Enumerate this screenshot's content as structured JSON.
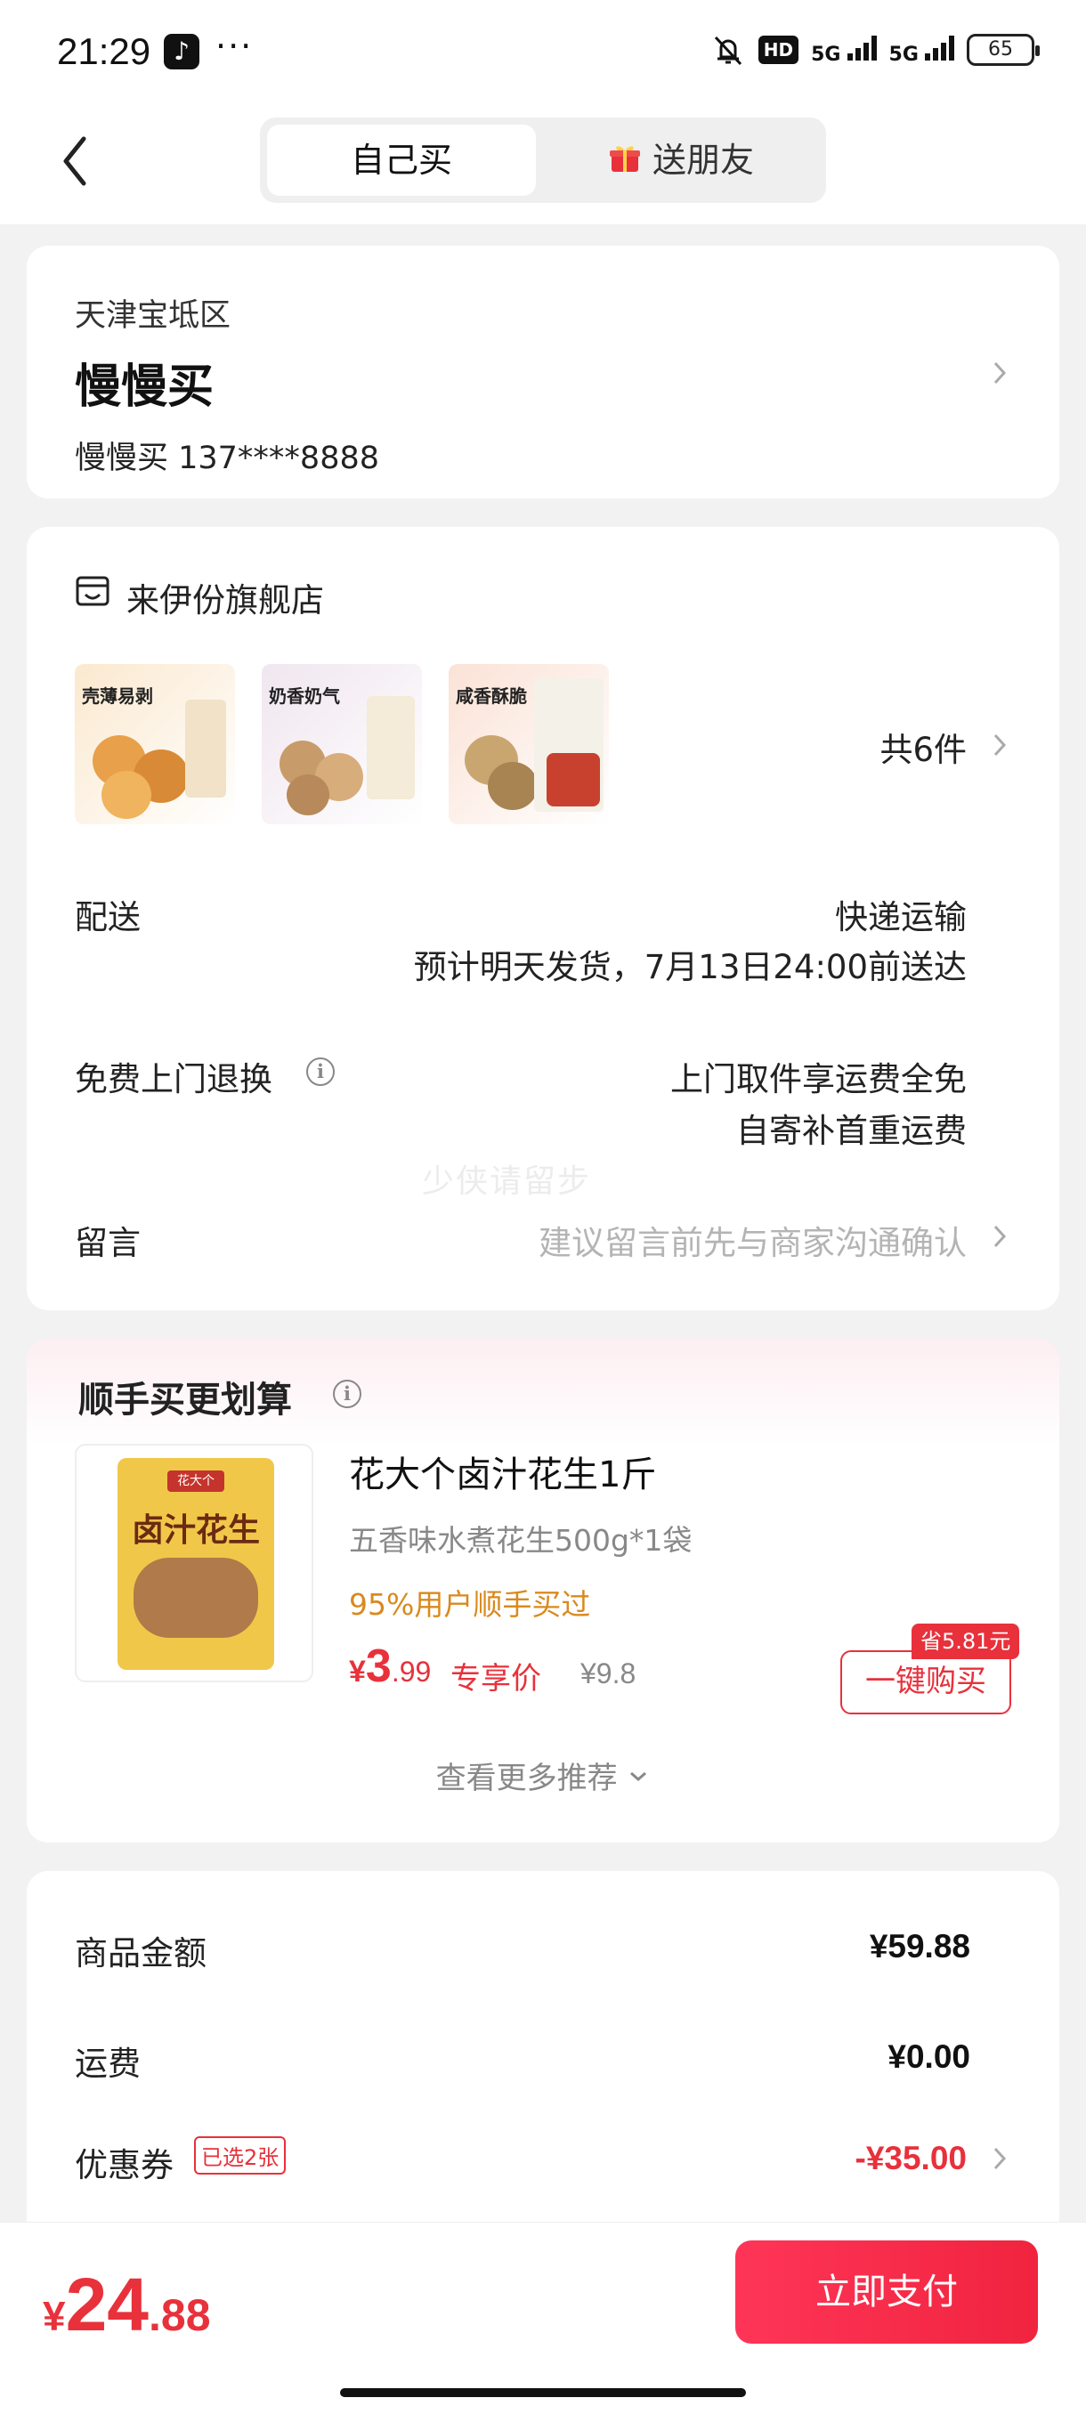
{
  "status_bar": {
    "time": "21:29",
    "hd": "HD",
    "net1": "5G",
    "net2": "5G",
    "battery": "65"
  },
  "header": {
    "tab_self": "自己买",
    "tab_gift": "送朋友"
  },
  "address": {
    "region": "天津宝坻区",
    "name": "慢慢买",
    "contact": "慢慢买  137****8888"
  },
  "order": {
    "store_name": "来伊份旗舰店",
    "products": [
      {
        "tag": "壳薄易剥"
      },
      {
        "tag": "奶香奶气"
      },
      {
        "tag": "咸香酥脆"
      }
    ],
    "total_count": "共6件",
    "delivery_label": "配送",
    "delivery_method": "快递运输",
    "delivery_eta": "预计明天发货，7月13日24:00前送达",
    "return_label": "免费上门退换",
    "return_line1": "上门取件享运费全免",
    "return_line2": "自寄补首重运费",
    "watermark": "少侠请留步",
    "message_label": "留言",
    "message_placeholder": "建议留言前先与商家沟通确认"
  },
  "recommend": {
    "title": "顺手买更划算",
    "package_brand": "花大个",
    "package_name": "卤汁花生",
    "product_name": "花大个卤汁花生1斤",
    "description": "五香味水煮花生500g*1袋",
    "buyers": "95%用户顺手买过",
    "price_symbol": "¥",
    "price_int": "3",
    "price_dec": ".99",
    "exclusive_label": "专享价",
    "original_price": "¥9.8",
    "save_badge": "省5.81元",
    "buy_button": "一键购买",
    "more_label": "查看更多推荐"
  },
  "summary": {
    "goods_label": "商品金额",
    "goods_value": "¥59.88",
    "shipping_label": "运费",
    "shipping_value": "¥0.00",
    "coupon_label": "优惠券",
    "coupon_tag": "已选2张",
    "coupon_value": "-¥35.00"
  },
  "bottom": {
    "total_symbol": "¥",
    "total_int": "24",
    "total_dec": ".88",
    "pay_button": "立即支付"
  },
  "colors": {
    "accent": "#e8313b",
    "buyers": "#d98a1e",
    "page_bg": "#f2f2f2"
  }
}
